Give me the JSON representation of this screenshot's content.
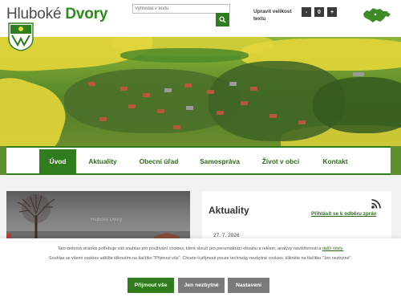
{
  "header": {
    "title_prefix": "Hluboké",
    "title_accent": "Dvory",
    "search": {
      "placeholder": "Vyhledat v textu"
    },
    "font_size_label": "Upravit velikost textu",
    "font_decrease": "-",
    "font_reset": "0",
    "font_increase": "+",
    "icons": {
      "search": "search-icon",
      "map": "czech-republic-map-icon",
      "crest": "coat-of-arms-icon"
    }
  },
  "nav": {
    "items": [
      {
        "label": "Úvod",
        "active": true
      },
      {
        "label": "Aktuality",
        "active": false
      },
      {
        "label": "Obecní úřad",
        "active": false
      },
      {
        "label": "Samospráva",
        "active": false
      },
      {
        "label": "Život v obci",
        "active": false
      },
      {
        "label": "Kontakt",
        "active": false
      }
    ]
  },
  "news": {
    "title": "Aktuality",
    "subscribe_label": "Přihlásit se k odběru zpráv",
    "date": "27. 7. 2026",
    "icons": {
      "rss": "rss-icon"
    }
  },
  "photo": {
    "watermark": "Hluboké Dvory"
  },
  "cookies": {
    "line1_prefix": "Tato webová stránka potřebuje váš souhlas pro používání cookies, které slouží pro personalizaci obsahu a reklam, analýzy návštěvnosti a",
    "line1_link": "další účely.",
    "line2": "Souhlas se všemi cookies udělíte kliknutím na tlačítko \"Přijmout vše\". Chcete-li přijmout pouze technicky nezbytné cookies, klikněte na tlačítko \"Jen nezbytné\".",
    "accept_all": "Přijmout vše",
    "necessary_only": "Jen nezbytné",
    "settings": "Nastavení"
  },
  "colors": {
    "brand_green": "#2f7d1c",
    "nav_text": "#2f6a1c",
    "button_gray": "#7a7a7a"
  }
}
